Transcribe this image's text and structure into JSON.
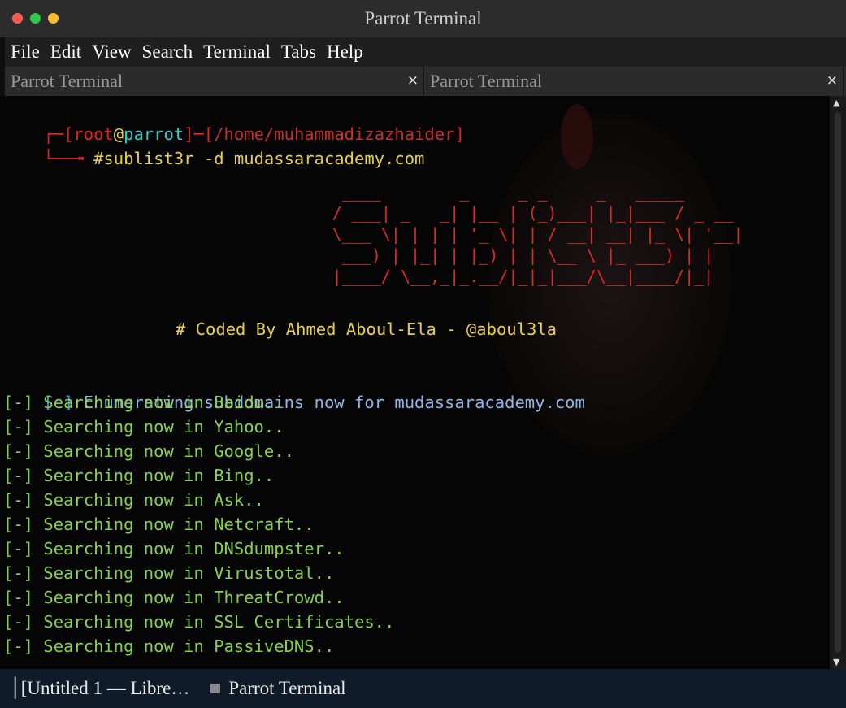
{
  "window": {
    "title": "Parrot Terminal"
  },
  "menu": [
    "File",
    "Edit",
    "View",
    "Search",
    "Terminal",
    "Tabs",
    "Help"
  ],
  "tabs": [
    {
      "label": "Parrot Terminal",
      "close": "×"
    },
    {
      "label": "Parrot Terminal",
      "close": "×"
    }
  ],
  "prompt": {
    "corner_top": "┌─",
    "open_bracket": "[",
    "user": "root",
    "at": "@",
    "host": "parrot",
    "sep": "]─[",
    "path": "/home/muhammadizazhaider",
    "close_bracket": "]",
    "corner_bottom": "└──╼ ",
    "command": "#sublist3r -d mudassaracademy.com"
  },
  "banner": "                 ____        _     _ _     _   _____\n                / ___| _   _| |__ | (_)___| |_|___ / _ __\n                \\___ \\| | | | '_ \\| | / __| __| |_ \\| '__|\n                 ___) | |_| | |_) | | \\__ \\ |_ ___) | |\n                |____/ \\__,_|_.__/|_|_|___/\\__|____/|_|",
  "coded_by": "# Coded By Ahmed Aboul-Ela - @aboul3la",
  "output": {
    "marker": "[-]",
    "enumerating": "Enumerating subdomains now for mudassaracademy.com",
    "searches": [
      "Searching now in Baidu..",
      "Searching now in Yahoo..",
      "Searching now in Google..",
      "Searching now in Bing..",
      "Searching now in Ask..",
      "Searching now in Netcraft..",
      "Searching now in DNSdumpster..",
      "Searching now in Virustotal..",
      "Searching now in ThreatCrowd..",
      "Searching now in SSL Certificates..",
      "Searching now in PassiveDNS.."
    ]
  },
  "scrollbar": {
    "up": "▲",
    "down": "▼"
  },
  "taskbar": [
    {
      "label": "[Untitled 1 — Libre…",
      "icon": "window-icon"
    },
    {
      "label": "Parrot Terminal",
      "icon": "terminal-icon"
    }
  ],
  "colors": {
    "prompt_red": "#e4251d",
    "host_cyan": "#2fd0c9",
    "command_yellow": "#e9d04a",
    "output_green": "#86d24c",
    "marker_blue": "#3e8ee0",
    "enum_lightblue": "#8fb6e8",
    "taskbar_bg": "#0f1b28"
  }
}
